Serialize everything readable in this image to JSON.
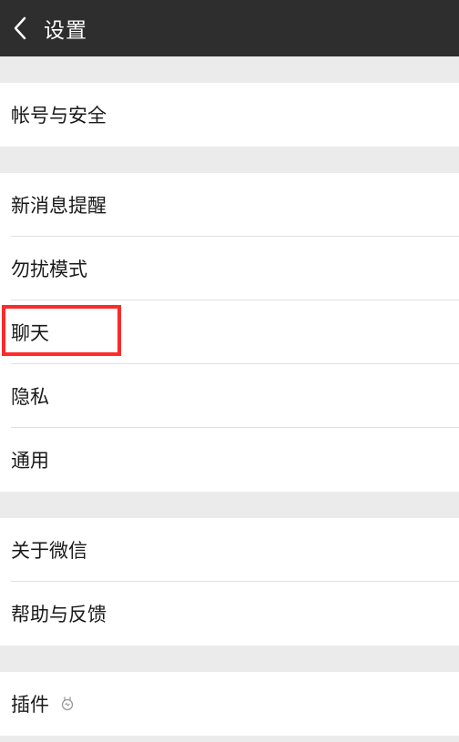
{
  "header": {
    "title": "设置"
  },
  "groups": [
    {
      "items": [
        {
          "label": "帐号与安全"
        }
      ]
    },
    {
      "items": [
        {
          "label": "新消息提醒"
        },
        {
          "label": "勿扰模式"
        },
        {
          "label": "聊天"
        },
        {
          "label": "隐私"
        },
        {
          "label": "通用"
        }
      ]
    },
    {
      "items": [
        {
          "label": "关于微信"
        },
        {
          "label": "帮助与反馈"
        }
      ]
    },
    {
      "items": [
        {
          "label": "插件",
          "icon": "plugin-icon"
        }
      ]
    }
  ],
  "colors": {
    "header_bg": "#2e2e2e",
    "page_bg": "#ebebeb",
    "highlight": "#ff2a2a"
  }
}
